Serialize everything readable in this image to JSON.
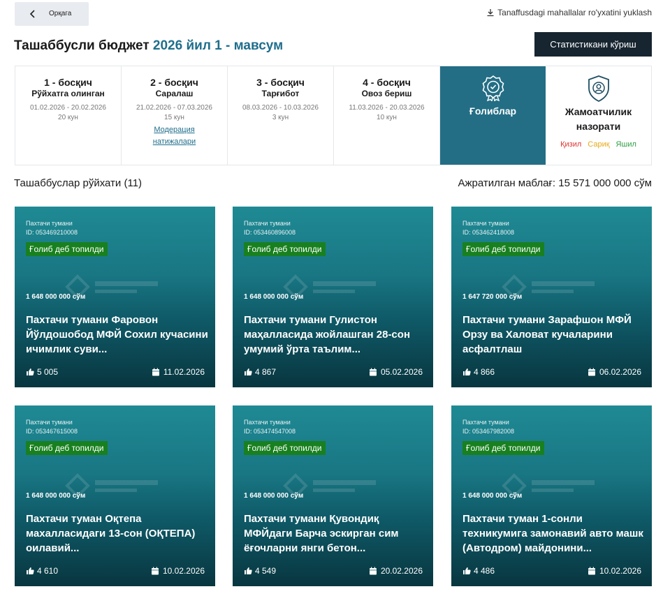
{
  "header": {
    "back_label": "Орқага",
    "download_label": "Tanaffusdagi mahallalar ro'yxatini yuklash",
    "title_main": "Ташаббусли бюджет",
    "title_accent": "2026 йил 1 - мавсум",
    "stats_button": "Статистикани кўриш"
  },
  "stages": [
    {
      "title": "1 - босқич",
      "subtitle": "Рўйхатга олинган",
      "dates": "01.02.2026 - 20.02.2026",
      "days": "20 кун"
    },
    {
      "title": "2 - босқич",
      "subtitle": "Саралаш",
      "dates": "21.02.2026 - 07.03.2026",
      "days": "15 кун",
      "link": "Модерация натижалари"
    },
    {
      "title": "3 - босқич",
      "subtitle": "Тарғибот",
      "dates": "08.03.2026 - 10.03.2026",
      "days": "3 кун"
    },
    {
      "title": "4 - босқич",
      "subtitle": "Овоз бериш",
      "dates": "11.03.2026 - 20.03.2026",
      "days": "10 кун"
    }
  ],
  "winners": {
    "label": "Ғолиблар",
    "icon": "award-badge-icon"
  },
  "public_control": {
    "label": "Жамоатчилик назорати",
    "icon": "shield-user-icon",
    "colors": [
      {
        "label": "Қизил",
        "color": "#e03131"
      },
      {
        "label": "Сариқ",
        "color": "#e8a917"
      },
      {
        "label": "Яшил",
        "color": "#2f9e44"
      }
    ]
  },
  "list": {
    "title": "Ташаббуслар рўйхати (11)",
    "allocated": "Ажратилган маблағ: 15 571 000 000 сўм"
  },
  "cards": [
    {
      "district": "Пахтачи тумани",
      "id": "ID: 053469210008",
      "badge": "Ғолиб деб топилди",
      "amount": "1 648 000 000 сўм",
      "title": "Пахтачи тумани Фаровон Йўлдошобод МФЙ Сохил кучасини ичимлик суви...",
      "votes": "5 005",
      "date": "11.02.2026"
    },
    {
      "district": "Пахтачи тумани",
      "id": "ID: 053460896008",
      "badge": "Ғолиб деб топилди",
      "amount": "1 648 000 000 сўм",
      "title": "Пахтачи тумани Гулистон маҳалласида жойлашган 28-сон умумий ўрта таълим...",
      "votes": "4 867",
      "date": "05.02.2026"
    },
    {
      "district": "Пахтачи тумани",
      "id": "ID: 053462418008",
      "badge": "Ғолиб деб топилди",
      "amount": "1 647 720 000 сўм",
      "title": "Пахтачи тумани Зарафшон МФЙ Орзу ва Халоват кучаларини асфалтлаш",
      "votes": "4 866",
      "date": "06.02.2026"
    },
    {
      "district": "Пахтачи тумани",
      "id": "ID: 053467615008",
      "badge": "Ғолиб деб топилди",
      "amount": "1 648 000 000 сўм",
      "title": "Пахтачи туман Оқтепа махалласидаги 13-сон (ОҚТЕПА) оилавий...",
      "votes": "4 610",
      "date": "10.02.2026"
    },
    {
      "district": "Пахтачи тумани",
      "id": "ID: 053474547008",
      "badge": "Ғолиб деб топилди",
      "amount": "1 648 000 000 сўм",
      "title": "Пахтачи тумани Қувондиқ МФЙдаги Барча эскирган сим ёғочларни янги бетон...",
      "votes": "4 549",
      "date": "20.02.2026"
    },
    {
      "district": "Пахтачи тумани",
      "id": "ID: 053467982008",
      "badge": "Ғолиб деб топилди",
      "amount": "1 648 000 000 сўм",
      "title": "Пахтачи туман 1-сонли техникумига замонавий авто машк (Автодром) майдонини...",
      "votes": "4 486",
      "date": "10.02.2026"
    }
  ]
}
